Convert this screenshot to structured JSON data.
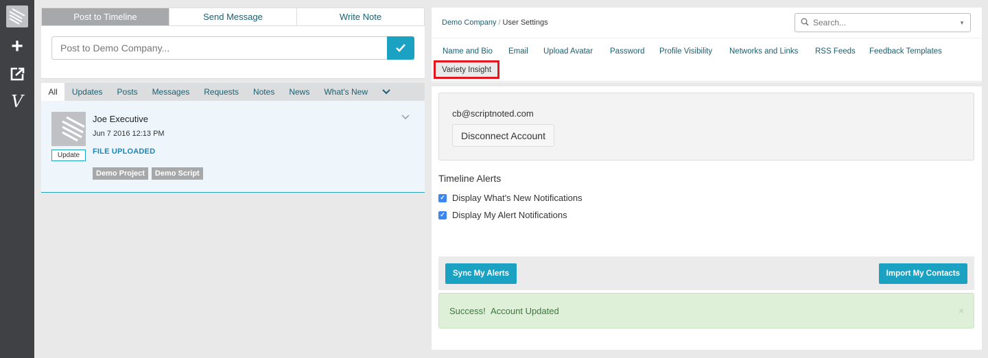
{
  "rail": {
    "icons": [
      "logo-icon",
      "plus-icon",
      "share-icon",
      "variety-icon"
    ],
    "v_glyph": "V"
  },
  "composer": {
    "tabs": [
      "Post to Timeline",
      "Send Message",
      "Write Note"
    ],
    "active_tab": "Post to Timeline",
    "post_placeholder": "Post to Demo Company..."
  },
  "feed_filter": {
    "items": [
      "All",
      "Updates",
      "Posts",
      "Messages",
      "Requests",
      "Notes",
      "News",
      "What's New"
    ],
    "active": "All"
  },
  "feed": {
    "items": [
      {
        "name": "Joe Executive",
        "date": "Jun 7 2016 12:13 PM",
        "badge": "Update",
        "action": "FILE UPLOADED",
        "tags": [
          "Demo Project",
          "Demo Script"
        ]
      }
    ]
  },
  "header": {
    "breadcrumb": [
      "Demo Company",
      "User Settings"
    ],
    "search_placeholder": "Search..."
  },
  "settings_tabs": {
    "items": [
      "Name and Bio",
      "Email",
      "Upload Avatar",
      "Password",
      "Profile Visibility",
      "Networks and Links",
      "RSS Feeds",
      "Feedback Templates",
      "Variety Insight"
    ],
    "active": "Variety Insight",
    "highlight_color": "#e3141b"
  },
  "account": {
    "email": "cb@scriptnoted.com",
    "disconnect_label": "Disconnect Account"
  },
  "alerts": {
    "title": "Timeline Alerts",
    "options": [
      {
        "label": "Display What's New Notifications",
        "checked": true
      },
      {
        "label": "Display My Alert Notifications",
        "checked": true
      }
    ]
  },
  "actions": {
    "sync_label": "Sync My Alerts",
    "import_label": "Import My Contacts",
    "accent": "#1ba2c3"
  },
  "message": {
    "strong": "Success!",
    "text": "Account Updated",
    "close": "×"
  }
}
